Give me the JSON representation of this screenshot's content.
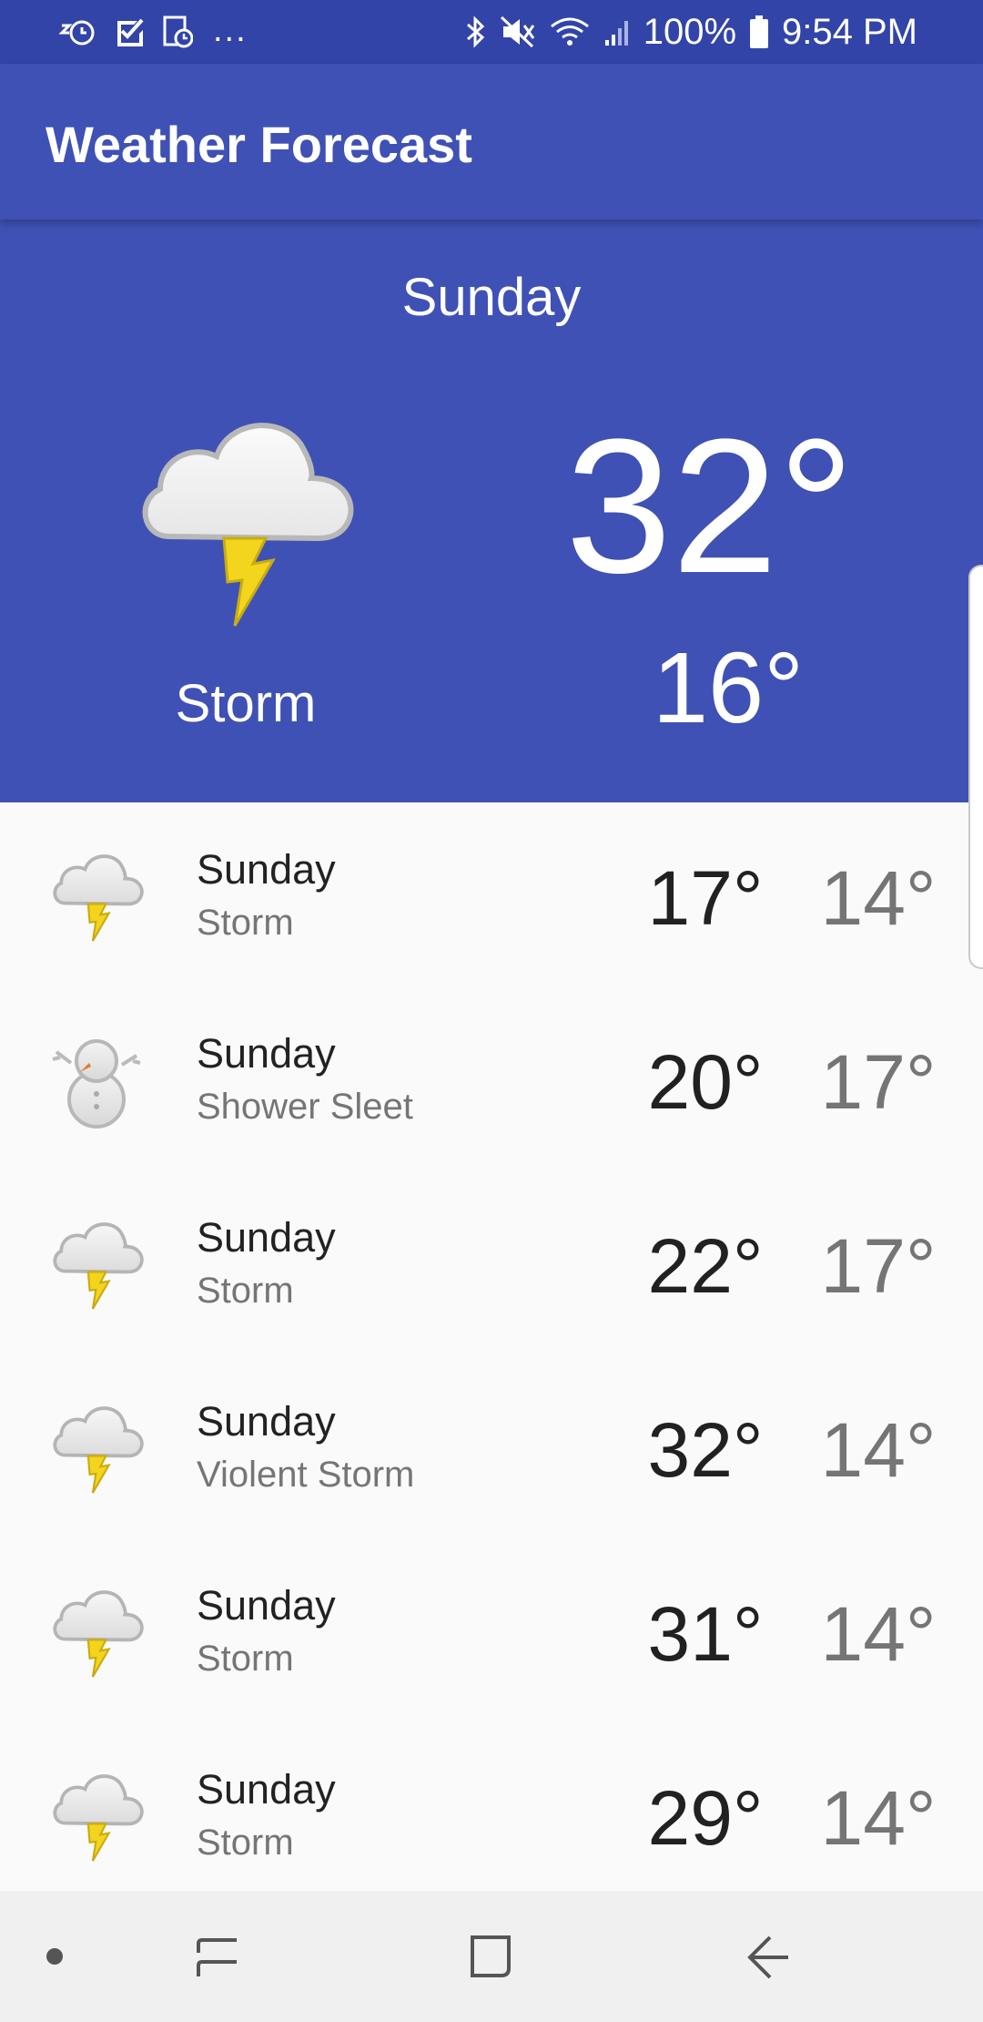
{
  "status_bar": {
    "overflow": "...",
    "battery": "100%",
    "time": "9:54 PM",
    "icons_left": [
      "alarm-snooze-icon",
      "checkbox-icon",
      "clock-file-icon"
    ],
    "icons_right": [
      "bluetooth-icon",
      "mute-icon",
      "wifi-icon",
      "signal-icon",
      "battery-icon"
    ]
  },
  "app_bar": {
    "title": "Weather Forecast"
  },
  "current": {
    "day": "Sunday",
    "condition": "Storm",
    "high": "32°",
    "low": "16°",
    "icon": "storm-icon"
  },
  "forecast": [
    {
      "day": "Sunday",
      "condition": "Storm",
      "high": "17°",
      "low": "14°",
      "icon": "storm-icon"
    },
    {
      "day": "Sunday",
      "condition": "Shower Sleet",
      "high": "20°",
      "low": "17°",
      "icon": "snowman-icon"
    },
    {
      "day": "Sunday",
      "condition": "Storm",
      "high": "22°",
      "low": "17°",
      "icon": "storm-icon"
    },
    {
      "day": "Sunday",
      "condition": "Violent Storm",
      "high": "32°",
      "low": "14°",
      "icon": "storm-icon"
    },
    {
      "day": "Sunday",
      "condition": "Storm",
      "high": "31°",
      "low": "14°",
      "icon": "storm-icon"
    },
    {
      "day": "Sunday",
      "condition": "Storm",
      "high": "29°",
      "low": "14°",
      "icon": "storm-icon"
    }
  ],
  "nav_bar": {
    "items": [
      "dot-icon",
      "recents-icon",
      "home-icon",
      "back-icon"
    ]
  },
  "colors": {
    "primary": "#3f51b5",
    "primary_dark": "#3344a8",
    "background": "#fafafa",
    "lightning": "#f2d51c"
  }
}
